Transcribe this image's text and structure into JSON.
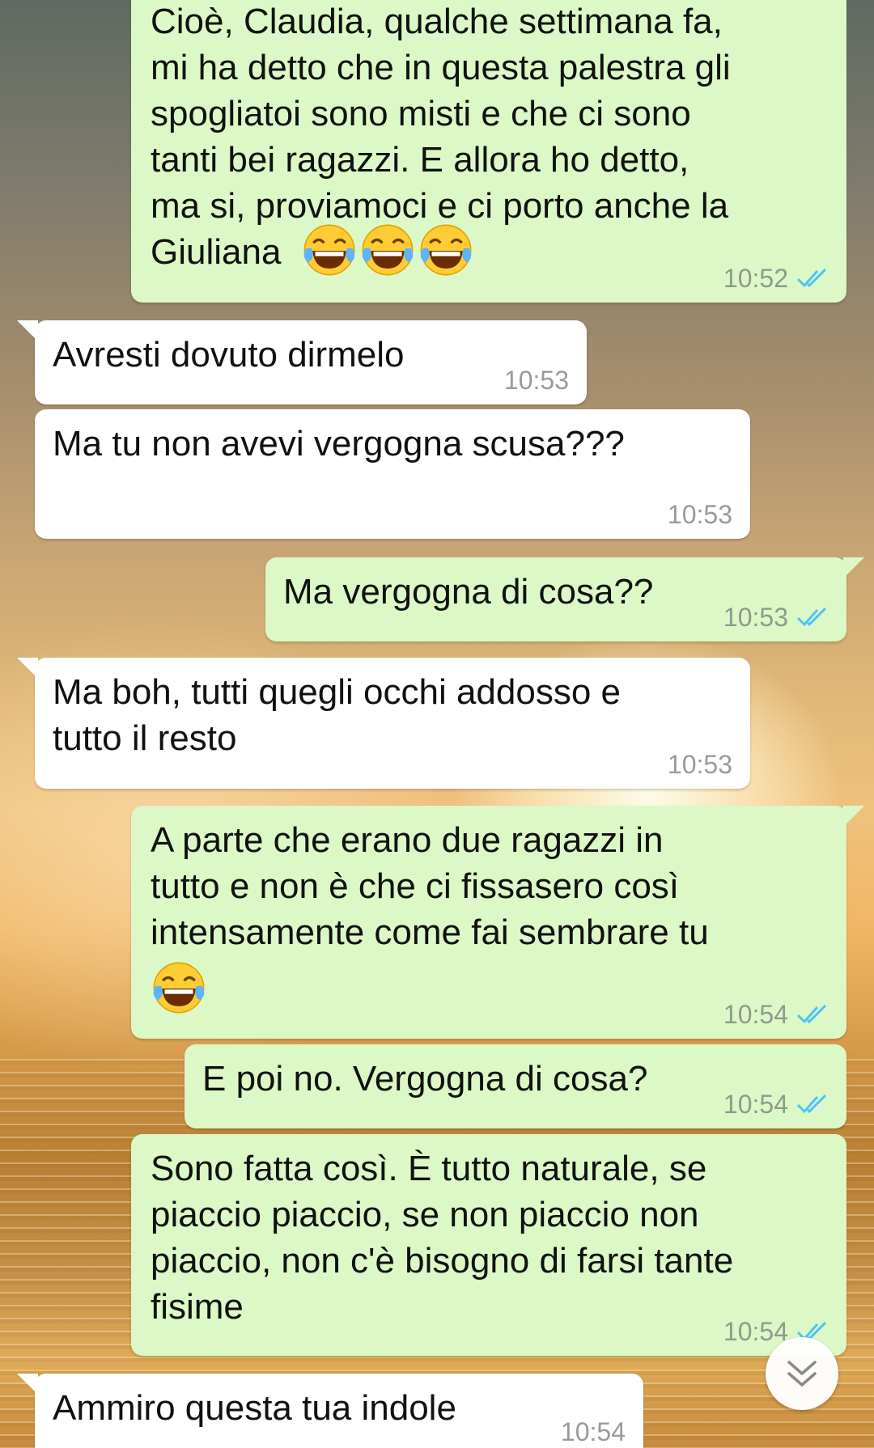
{
  "messages": [
    {
      "direction": "outgoing",
      "text": "Cioè, Claudia, qualche settimana fa,\nmi ha detto che in questa palestra gli\nspogliatoi sono misti e che ci sono\ntanti bei ragazzi. E allora ho detto,\nma si, proviamoci e ci porto anche la\nGiuliana",
      "emoji": [
        "face-with-tears-of-joy",
        "face-with-tears-of-joy",
        "face-with-tears-of-joy"
      ],
      "time": "10:52",
      "status": "read"
    },
    {
      "direction": "incoming",
      "text": "Avresti dovuto dirmelo",
      "time": "10:53"
    },
    {
      "direction": "incoming",
      "text": "Ma tu non avevi vergogna scusa???",
      "time": "10:53"
    },
    {
      "direction": "outgoing",
      "text": "Ma vergogna di cosa??",
      "time": "10:53",
      "status": "read"
    },
    {
      "direction": "incoming",
      "text": "Ma boh, tutti quegli occhi addosso e\ntutto il resto",
      "time": "10:53"
    },
    {
      "direction": "outgoing",
      "text": "A parte che erano due ragazzi in\ntutto e non è che ci fissasero così\nintensamente come fai sembrare tu",
      "emoji": [
        "face-with-tears-of-joy"
      ],
      "time": "10:54",
      "status": "read"
    },
    {
      "direction": "outgoing",
      "text": "E poi no. Vergogna di cosa?",
      "time": "10:54",
      "status": "read"
    },
    {
      "direction": "outgoing",
      "text": "Sono fatta così. È tutto naturale, se\npiaccio piaccio, se non piaccio non\npiaccio, non c'è bisogno di farsi tante\nfisime",
      "time": "10:54",
      "status": "read"
    },
    {
      "direction": "incoming",
      "text": "Ammiro questa tua indole",
      "time": "10:54"
    }
  ],
  "icons": {
    "read_receipt": "double-check-icon",
    "scroll_down": "chevron-double-down-icon",
    "emoji": "face-with-tears-of-joy"
  },
  "colors": {
    "outgoing_bubble": "#dcf8c6",
    "incoming_bubble": "#ffffff",
    "read_tick": "#4fc3f7",
    "timestamp": "#8f9a8c"
  }
}
